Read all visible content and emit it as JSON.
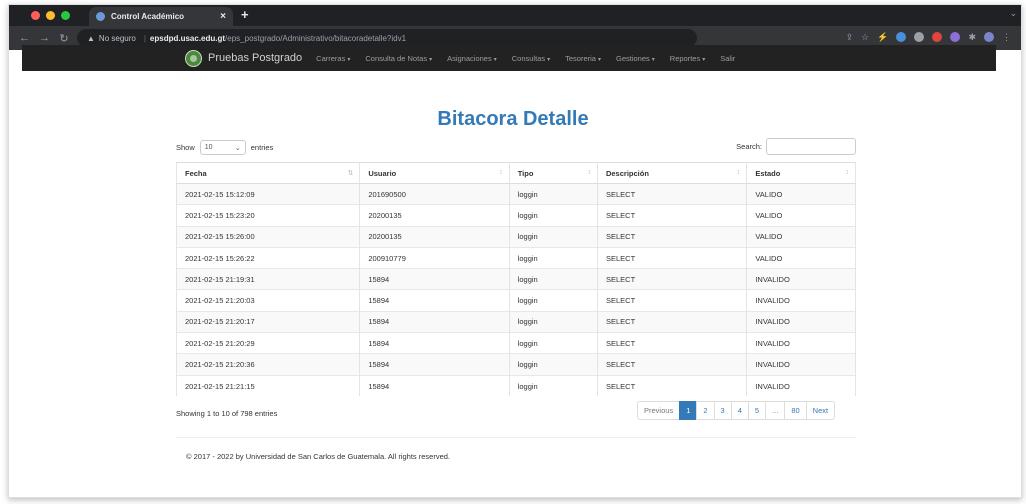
{
  "browser": {
    "tab_title": "Control Académico",
    "tab_close": "×",
    "new_tab": "+",
    "not_secure": "No seguro",
    "url_host": "epsdpd.usac.edu.gt",
    "url_path": "/eps_postgrado/Administrativo/bitacoradetalle?idv1",
    "traffic_colors": [
      "#ff5f57",
      "#febc2e",
      "#28c840"
    ]
  },
  "navbar": {
    "brand": "Pruebas Postgrado",
    "menu": [
      {
        "label": "Carreras",
        "caret": true
      },
      {
        "label": "Consulta de Notas",
        "caret": true
      },
      {
        "label": "Asignaciones",
        "caret": true
      },
      {
        "label": "Consultas",
        "caret": true
      },
      {
        "label": "Tesoreria",
        "caret": true
      },
      {
        "label": "Gestiones",
        "caret": true
      },
      {
        "label": "Reportes",
        "caret": true
      },
      {
        "label": "Salir",
        "caret": false
      }
    ]
  },
  "page": {
    "title": "Bitacora Detalle",
    "show_label": "Show",
    "entries_value": "10",
    "entries_label": "entries",
    "search_label": "Search:"
  },
  "table": {
    "columns": [
      "Fecha",
      "Usuario",
      "Tipo",
      "Descripción",
      "Estado"
    ],
    "rows": [
      [
        "2021-02-15 15:12:09",
        "201690500",
        "loggin",
        "SELECT",
        "VALIDO"
      ],
      [
        "2021-02-15 15:23:20",
        "20200135",
        "loggin",
        "SELECT",
        "VALIDO"
      ],
      [
        "2021-02-15 15:26:00",
        "20200135",
        "loggin",
        "SELECT",
        "VALIDO"
      ],
      [
        "2021-02-15 15:26:22",
        "200910779",
        "loggin",
        "SELECT",
        "VALIDO"
      ],
      [
        "2021-02-15 21:19:31",
        "15894",
        "loggin",
        "SELECT",
        "INVALIDO"
      ],
      [
        "2021-02-15 21:20:03",
        "15894",
        "loggin",
        "SELECT",
        "INVALIDO"
      ],
      [
        "2021-02-15 21:20:17",
        "15894",
        "loggin",
        "SELECT",
        "INVALIDO"
      ],
      [
        "2021-02-15 21:20:29",
        "15894",
        "loggin",
        "SELECT",
        "INVALIDO"
      ],
      [
        "2021-02-15 21:20:36",
        "15894",
        "loggin",
        "SELECT",
        "INVALIDO"
      ],
      [
        "2021-02-15 21:21:15",
        "15894",
        "loggin",
        "SELECT",
        "INVALIDO"
      ]
    ]
  },
  "pagination": {
    "info": "Showing 1 to 10 of 798 entries",
    "previous": "Previous",
    "pages": [
      "1",
      "2",
      "3",
      "4",
      "5",
      "...",
      "80"
    ],
    "next": "Next"
  },
  "footer": {
    "text": "© 2017 - 2022 by Universidad de San Carlos de Guatemala. All rights reserved."
  },
  "colors": {
    "accent": "#337ab7",
    "navbar_bg": "#222222"
  }
}
